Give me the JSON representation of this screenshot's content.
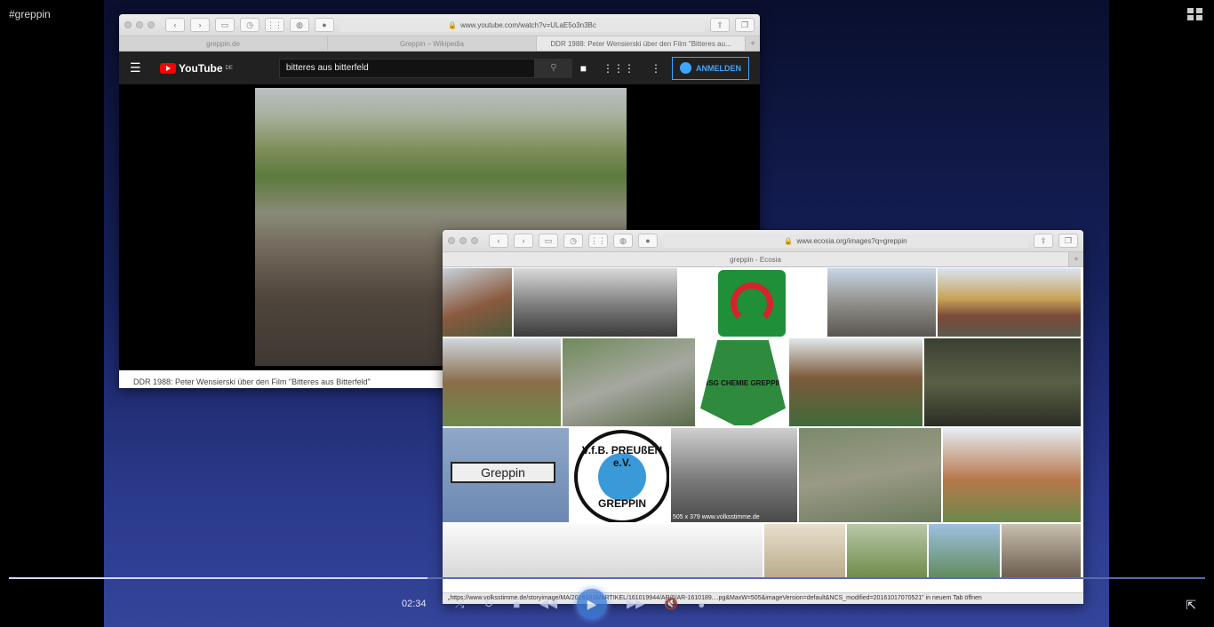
{
  "overlay": {
    "hashtag": "#greppin"
  },
  "player": {
    "time": "02:34",
    "progress": 0.35
  },
  "youtube_window": {
    "url": "www.youtube.com/watch?v=ULaE5o3n3Bc",
    "tabs": [
      "greppin.de",
      "Greppin – Wikipedia",
      "DDR 1988: Peter Wensierski über den Film \"Bitteres au..."
    ],
    "logo": "YouTube",
    "logo_region": "DE",
    "search_value": "bitteres aus bitterfeld",
    "signin_label": "ANMELDEN",
    "below_title": "DDR 1988: Peter Wensierski über den Film \"Bitteres aus Bitterfeld\""
  },
  "ecosia_window": {
    "url": "www.ecosia.org/images?q=greppin",
    "tab_title": "greppin - Ecosia",
    "sign_text": "Greppin",
    "caption": "505 x 379 www.volksstimme.de",
    "logo_top": "V.f.B. PREUßEN e.V.",
    "logo_bottom": "GREPPIN",
    "badge_text": "BSG CHEMIE GREPPIN",
    "status": "„https://www.volksstimme.de/storyimage/MA/20161016/ARTIKEL/161019944/AR/0/AR-1610189....pg&MaxW=505&imageVersion=default&NCS_modified=20161017070521\" in neuem Tab öffnen"
  },
  "colors": {
    "accent": "#3ea6ff",
    "youtube_red": "#ff0000"
  }
}
